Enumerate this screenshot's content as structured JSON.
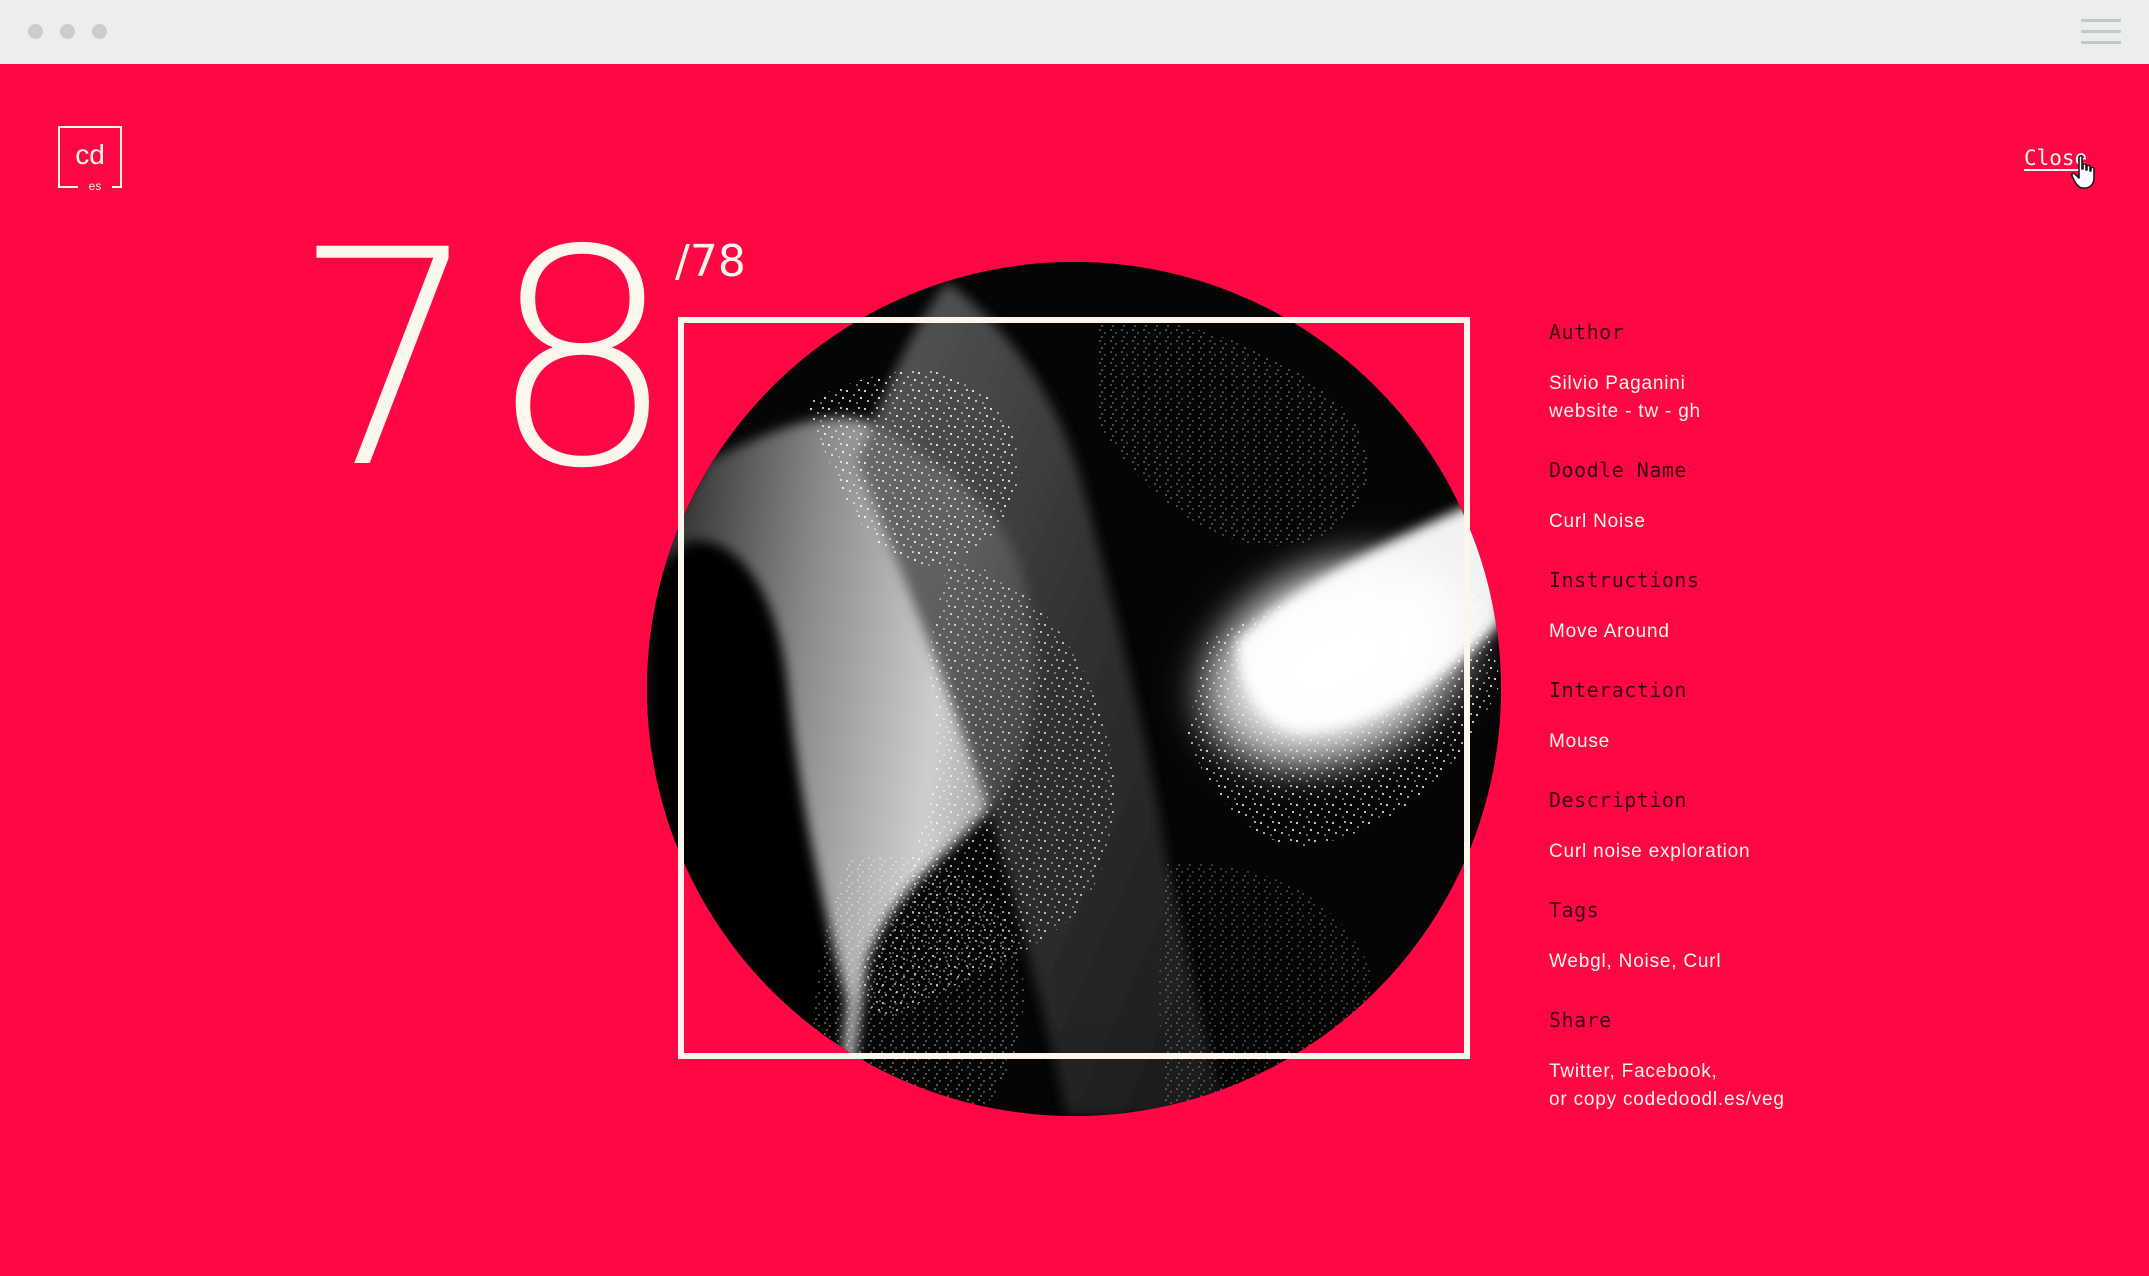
{
  "logo": {
    "main": "cd",
    "sub": "es"
  },
  "close_label": "Close",
  "doodle_number": "78",
  "doodle_total": "/78",
  "info": [
    {
      "label": "Author",
      "lines": [
        "Silvio Paganini",
        "website - tw - gh"
      ]
    },
    {
      "label": "Doodle Name",
      "lines": [
        "Curl Noise"
      ]
    },
    {
      "label": "Instructions",
      "lines": [
        "Move Around"
      ]
    },
    {
      "label": "Interaction",
      "lines": [
        "Mouse"
      ]
    },
    {
      "label": "Description",
      "lines": [
        "Curl noise exploration"
      ]
    },
    {
      "label": "Tags",
      "lines": [
        "Webgl, Noise, Curl"
      ]
    },
    {
      "label": "Share",
      "lines": [
        "Twitter, Facebook,",
        "or copy codedoodl.es/veg"
      ]
    }
  ],
  "colors": {
    "background": "#ff0645",
    "cream": "#fcf7ec",
    "label": "#3a0016",
    "chrome": "#eceeee"
  },
  "icons": {
    "window_controls": "traffic-light-dots",
    "menu": "hamburger-icon",
    "cursor": "hand-pointer-icon"
  }
}
